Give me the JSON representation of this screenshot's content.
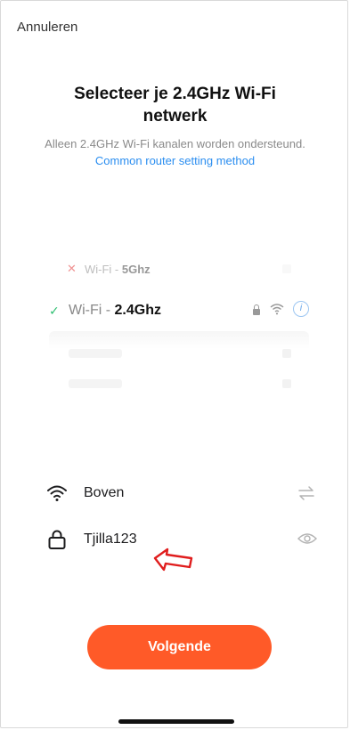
{
  "header": {
    "cancel_label": "Annuleren"
  },
  "title": "Selecteer je 2.4GHz Wi-Fi netwerk",
  "subtitle": {
    "text": "Alleen 2.4GHz Wi-Fi kanalen worden ondersteund.",
    "link": "Common router setting method"
  },
  "illustration": {
    "unsupported": {
      "prefix": "Wi-Fi - ",
      "band": "5Ghz"
    },
    "supported": {
      "prefix": "Wi-Fi - ",
      "band": "2.4Ghz"
    }
  },
  "form": {
    "ssid_value": "Boven",
    "password_value": "Tjilla123"
  },
  "next_label": "Volgende",
  "colors": {
    "accent": "#ff5a28",
    "link": "#2b8ef0",
    "check": "#2fbf72",
    "cross": "#e23a3a"
  }
}
